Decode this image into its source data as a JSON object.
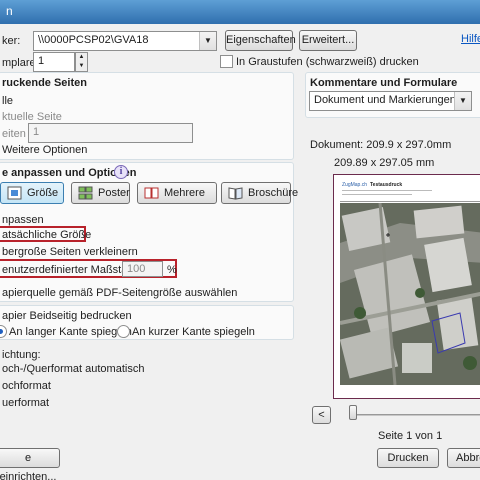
{
  "window": {
    "title": "n"
  },
  "printer": {
    "label": "ker:",
    "value": "\\\\0000PCSP02\\GVA18",
    "properties_button": "Eigenschaften",
    "advanced_button": "Erweitert...",
    "help_link": "Hilfe",
    "copies_label": "mplare:",
    "copies_value": "1",
    "grayscale_label": "In Graustufen (schwarzweiß) drucken"
  },
  "pages": {
    "heading": "ruckende Seiten",
    "all_label": "lle",
    "current_label": "ktuelle Seite",
    "pages_label": "eiten",
    "pages_value": "1",
    "more_options": "Weitere Optionen"
  },
  "sizing": {
    "heading": "e anpassen und Optionen",
    "info_icon": "info-icon",
    "tabs": [
      {
        "label": "Größe",
        "icon": "size-icon"
      },
      {
        "label": "Poster",
        "icon": "poster-icon"
      },
      {
        "label": "Mehrere",
        "icon": "multiple-pages-icon"
      },
      {
        "label": "Broschüre",
        "icon": "booklet-icon"
      }
    ],
    "fit_label": "npassen",
    "actual_size_label": "atsächliche Größe",
    "shrink_label": "bergroße Seiten verkleinern",
    "custom_scale_label": "enutzerdefinierter Maßstab:",
    "custom_scale_value": "100",
    "percent": "%",
    "paper_source_label": "apierquelle gemäß PDF-Seitengröße auswählen"
  },
  "duplex": {
    "label": "apier Beidseitig bedrucken",
    "long_edge": "An langer Kante spiegeln",
    "short_edge": "An kurzer Kante spiegeln"
  },
  "orientation": {
    "heading": "ichtung:",
    "auto": "och-/Querformat automatisch",
    "portrait": "ochformat",
    "landscape": "uerformat"
  },
  "comments": {
    "heading": "Kommentare und Formulare",
    "value": "Dokument und Markierungen"
  },
  "preview": {
    "document_size": "Dokument: 209.9 x 297.0mm",
    "page_size": "209.89 x 297.05 mm",
    "page_indicator": "Seite 1 von 1",
    "prev": "<",
    "next": ">",
    "map_header_logo": "ZugMap.ch",
    "map_header_title": "Testausdruck"
  },
  "footer": {
    "page_setup_button": "e einrichten...",
    "print_button": "Drucken",
    "cancel_button": "Abbre"
  }
}
